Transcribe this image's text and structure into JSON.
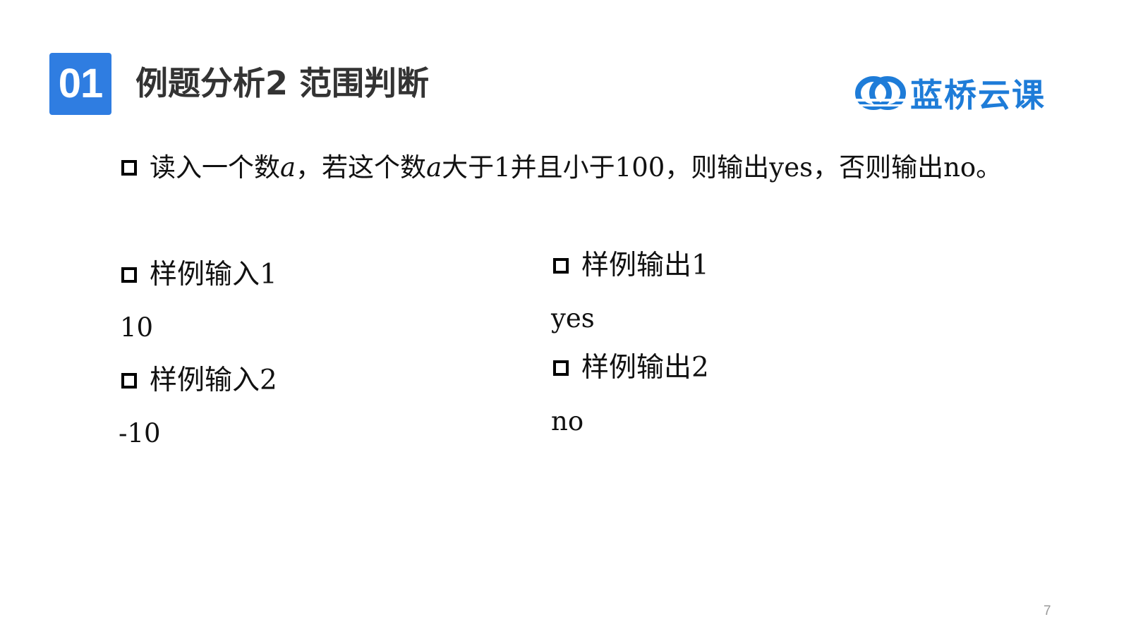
{
  "header": {
    "section_number": "01",
    "title": "例题分析2 范围判断"
  },
  "brand": {
    "name": "蓝桥云课",
    "color": "#1e7cd8",
    "icon": "lanqiao-logo-icon"
  },
  "problem": {
    "parts": [
      "读入一个数",
      "a",
      "，若这个数",
      "a",
      "大于1并且小于100，则输出yes，否则输出no。"
    ]
  },
  "samples": {
    "input_1": {
      "label": "样例输入1",
      "value": "10"
    },
    "input_2": {
      "label": "样例输入2",
      "value": "-10"
    },
    "output_1": {
      "label": "样例输出1",
      "value": "yes"
    },
    "output_2": {
      "label": "样例输出2",
      "value": "no"
    }
  },
  "page_number": "7",
  "colors": {
    "badge": "#2f7de1",
    "title": "#333333",
    "text": "#111111",
    "page_number": "#999999"
  }
}
